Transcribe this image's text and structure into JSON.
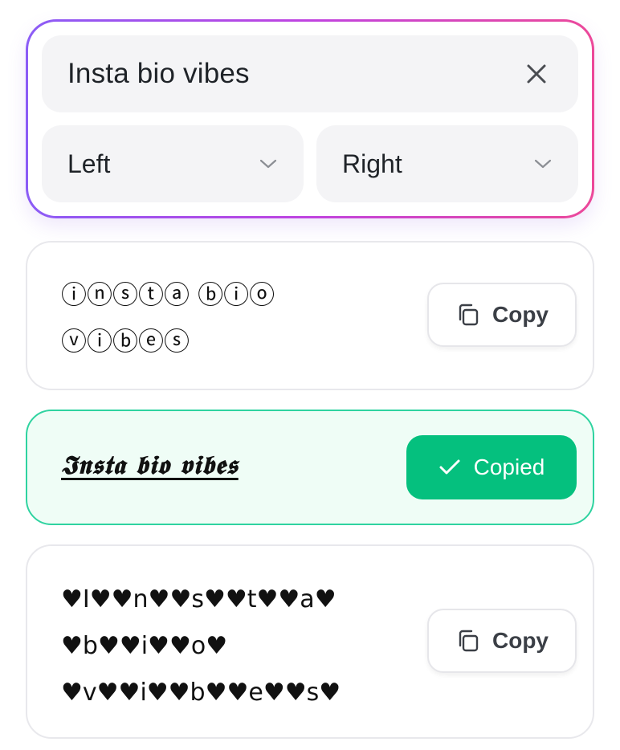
{
  "controls": {
    "input_value": "Insta bio vibes",
    "left_select": "Left",
    "right_select": "Right"
  },
  "results": [
    {
      "text": "ⓘⓝⓢⓣⓐ ⓑⓘⓞ ⓥⓘⓑⓔⓢ",
      "button_label": "Copy",
      "state": "default"
    },
    {
      "text": "𝕴𝖓𝖘𝖙𝖆 𝖇𝖎𝖔 𝖛𝖎𝖇𝖊𝖘",
      "button_label": "Copied",
      "state": "copied"
    },
    {
      "text": "♥I♥♥n♥♥s♥♥t♥♥a♥ ♥b♥♥i♥♥o♥ ♥v♥♥i♥♥b♥♥e♥♥s♥",
      "button_label": "Copy",
      "state": "default"
    }
  ],
  "colors": {
    "gradient_start": "#8b5cf6",
    "gradient_end": "#ec4899",
    "copied_green": "#05c07e",
    "copied_card_border": "#2fd3a0"
  },
  "icons": {
    "clear": "close-icon",
    "select": "chevron-down-icon",
    "copy": "copy-icon",
    "copied": "checkmark-icon"
  }
}
